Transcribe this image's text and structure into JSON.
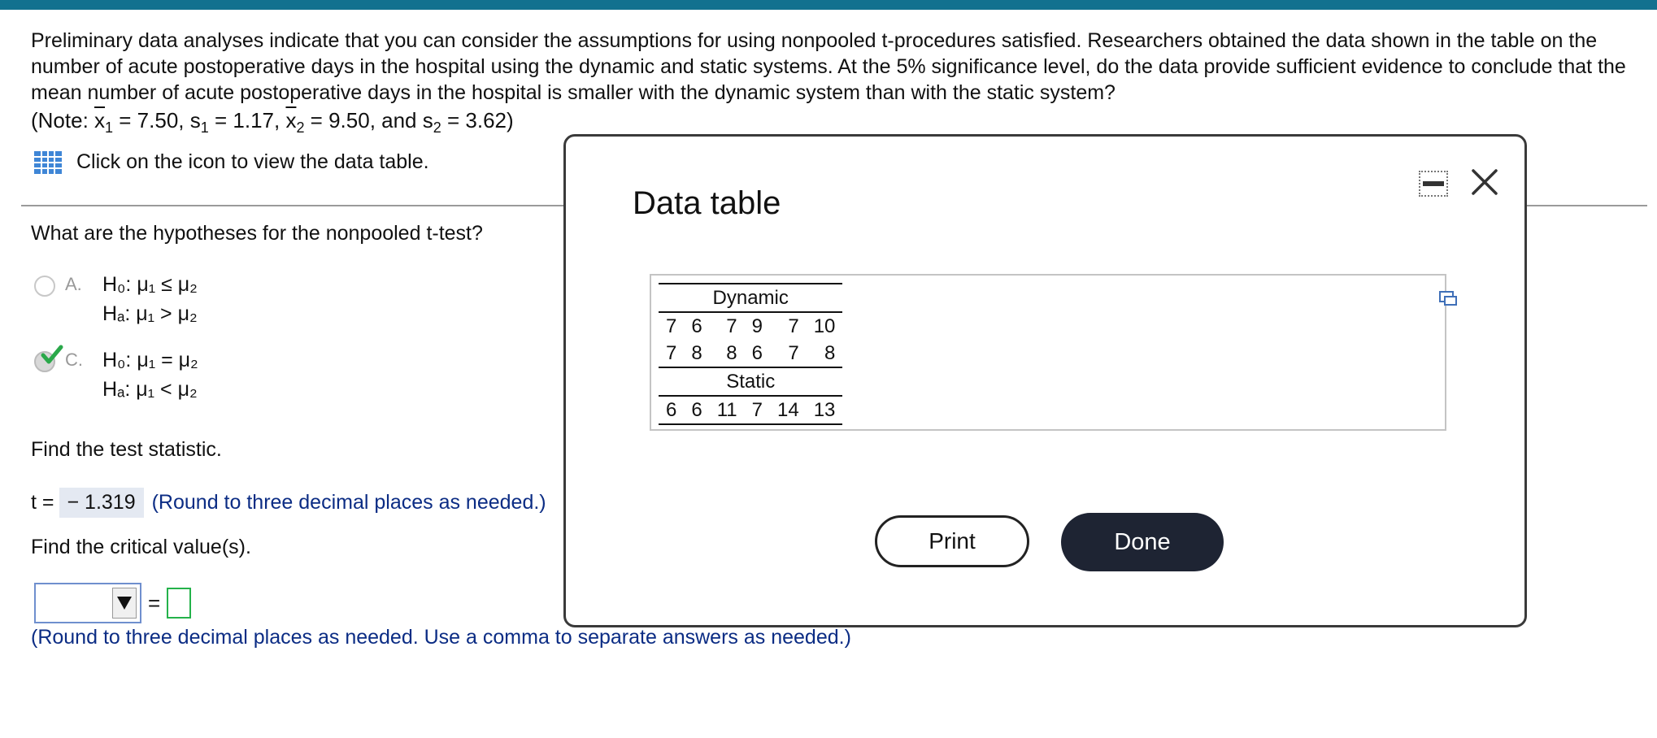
{
  "question": {
    "text": "Preliminary data analyses indicate that you can consider the assumptions for using nonpooled t-procedures satisfied. Researchers obtained the data shown in the table on the number of acute postoperative days in the hospital using the dynamic and static systems. At the 5% significance level, do the data provide sufficient evidence to conclude that the mean number of acute postoperative days in the hospital is smaller with the dynamic system than with the static system?",
    "note_prefix": "(Note: ",
    "xbar1": "x",
    "sub1": "1",
    "xbar1_value": " = 7.50, s",
    "s1_sub": "1",
    "s1_value": " = 1.17, ",
    "xbar2": "x",
    "sub2": "2",
    "xbar2_value": " = 9.50, and s",
    "s2_sub": "2",
    "s2_value": " = 3.62)",
    "icon_link": "Click on the icon to view the data table."
  },
  "hypotheses": {
    "prompt": "What are the hypotheses for the nonpooled t-test?",
    "options": [
      {
        "letter": "A.",
        "h0": "H₀: μ₁ ≤ μ₂",
        "ha": "Hₐ: μ₁ > μ₂",
        "selected": false
      },
      {
        "letter": "C.",
        "h0": "H₀: μ₁ = μ₂",
        "ha": "Hₐ: μ₁ < μ₂",
        "selected": true
      }
    ]
  },
  "test_statistic": {
    "prompt": "Find the test statistic.",
    "label": "t =",
    "value": "− 1.319",
    "hint": "(Round to three decimal places as needed.)"
  },
  "critical": {
    "prompt": "Find the critical value(s).",
    "equals": "=",
    "hint": "(Round to three decimal places as needed. Use a comma to separate answers as needed.)"
  },
  "modal": {
    "title": "Data table",
    "dynamic_label": "Dynamic",
    "dynamic_rows": [
      [
        "7",
        "6",
        "7",
        "9",
        "7",
        "10"
      ],
      [
        "7",
        "8",
        "8",
        "6",
        "7",
        "8"
      ]
    ],
    "static_label": "Static",
    "static_row": [
      "6",
      "6",
      "11",
      "7",
      "14",
      "13"
    ],
    "print_label": "Print",
    "done_label": "Done"
  },
  "colors": {
    "top_bar": "#12718f",
    "hint": "#0b2c84",
    "done_bg": "#1e2433",
    "check": "#2aa84a"
  }
}
